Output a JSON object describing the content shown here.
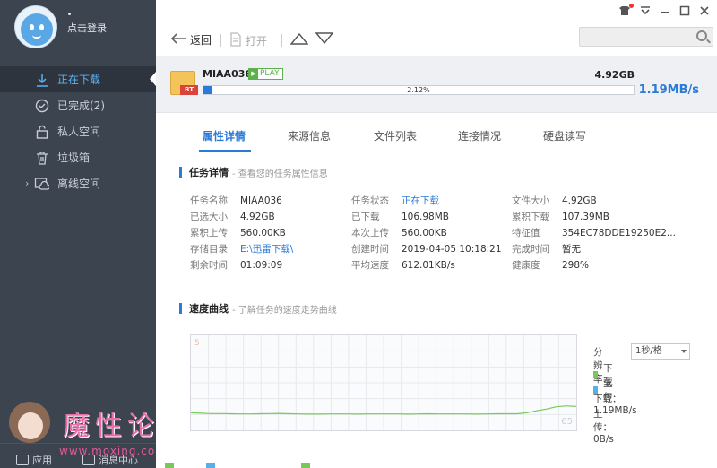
{
  "sidebar": {
    "login_text": "点击登录",
    "items": [
      {
        "label": "正在下载",
        "icon": "download-icon",
        "active": true
      },
      {
        "label": "已完成(2)",
        "icon": "check-circle-icon",
        "active": false
      },
      {
        "label": "私人空间",
        "icon": "lock-icon",
        "active": false
      },
      {
        "label": "垃圾箱",
        "icon": "trash-icon",
        "active": false
      },
      {
        "label": "离线空间",
        "icon": "cloud-icon",
        "active": false
      }
    ],
    "bottom": {
      "apps_label": "应用",
      "messages_label": "消息中心"
    }
  },
  "watermark": {
    "title": "魔性论坛",
    "url": "www.moxing.cool"
  },
  "toolbar": {
    "back_label": "返回",
    "open_label": "打开"
  },
  "task": {
    "name": "MIAA036",
    "play_label": "PLAY",
    "file_badge": "BT",
    "size": "4.92GB",
    "progress_text": "2.12%",
    "progress_value": 2.12,
    "speed": "1.19MB/s"
  },
  "tabs": [
    "属性详情",
    "来源信息",
    "文件列表",
    "连接情况",
    "硬盘读写"
  ],
  "task_details": {
    "title": "任务详情",
    "subtitle": "- 查看您的任务属性信息",
    "col1": [
      {
        "k": "任务名称",
        "v": "MIAA036"
      },
      {
        "k": "已选大小",
        "v": "4.92GB"
      },
      {
        "k": "累积上传",
        "v": "560.00KB"
      },
      {
        "k": "存储目录",
        "v": "E:\\迅雷下载\\"
      },
      {
        "k": "剩余时间",
        "v": "01:09:09"
      }
    ],
    "col2": [
      {
        "k": "任务状态",
        "v": "正在下载"
      },
      {
        "k": "已下载",
        "v": "106.98MB"
      },
      {
        "k": "本次上传",
        "v": "560.00KB"
      },
      {
        "k": "创建时间",
        "v": "2019-04-05 10:18:21"
      },
      {
        "k": "平均速度",
        "v": "612.01KB/s"
      }
    ],
    "col3": [
      {
        "k": "文件大小",
        "v": "4.92GB"
      },
      {
        "k": "累积下载",
        "v": "107.39MB"
      },
      {
        "k": "特征值",
        "v": "354EC78DDE19250E2..."
      },
      {
        "k": "完成时间",
        "v": "暂无"
      },
      {
        "k": "健康度",
        "v": "298%"
      }
    ]
  },
  "speed_curve": {
    "title": "速度曲线",
    "subtitle": "- 了解任务的速度走势曲线",
    "resolution_label": "分辨率:",
    "resolution_value": "1秒/格",
    "legend_download": "下载",
    "legend_upload": "上传",
    "download_rate": "下载：1.19MB/s",
    "upload_rate": "上传：0B/s",
    "ymax_label": "5",
    "yend_label": "65"
  },
  "colors": {
    "download": "#79c95a",
    "upload": "#5ab0e6",
    "accent": "#2b7ad8"
  },
  "chart_data": {
    "type": "line",
    "title": "",
    "xlabel": "",
    "ylabel": "",
    "series": [
      {
        "name": "下载",
        "values": [
          0.4,
          0.37,
          0.35,
          0.35,
          0.34,
          0.33,
          0.33,
          0.34,
          0.35,
          0.36,
          0.34,
          0.33,
          0.32,
          0.32,
          0.33,
          0.33,
          0.33,
          0.32,
          0.33,
          0.33,
          0.33,
          0.33,
          0.32,
          0.33,
          0.34,
          0.33,
          0.33,
          0.33,
          0.33,
          0.32,
          0.33,
          0.34,
          0.34,
          0.34,
          0.4,
          0.52,
          0.62,
          0.75,
          0.8,
          0.77
        ]
      },
      {
        "name": "上传",
        "values": [
          0,
          0,
          0,
          0,
          0,
          0,
          0,
          0,
          0,
          0,
          0,
          0,
          0,
          0,
          0,
          0,
          0,
          0,
          0,
          0,
          0,
          0,
          0,
          0,
          0,
          0,
          0,
          0,
          0,
          0,
          0,
          0,
          0,
          0,
          0,
          0,
          0,
          0,
          0,
          0
        ]
      }
    ],
    "ylim": [
      0,
      5
    ],
    "grid": true
  }
}
